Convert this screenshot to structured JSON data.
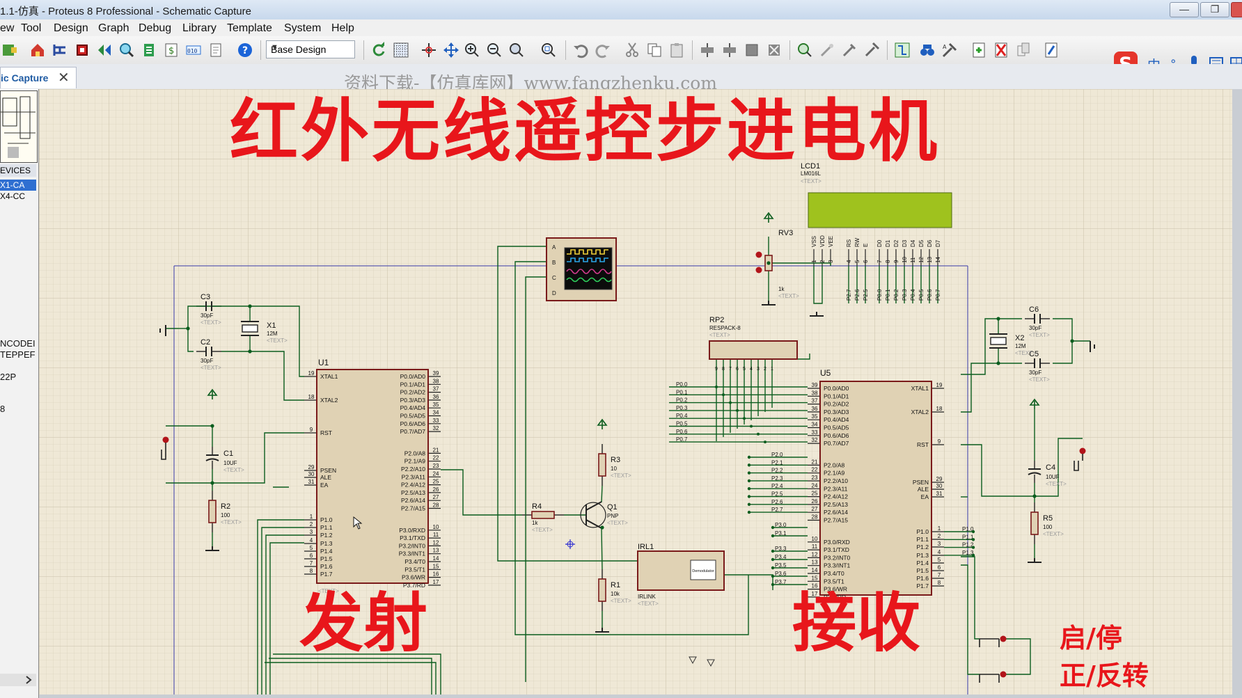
{
  "window": {
    "title": "1.1-仿真 - Proteus 8 Professional - Schematic Capture"
  },
  "menu": [
    "ew",
    "Tool",
    "Design",
    "Graph",
    "Debug",
    "Library",
    "Template",
    "System",
    "Help"
  ],
  "toolbar": {
    "design_select": "Base Design"
  },
  "tab": {
    "label": "ic Capture",
    "close": "✕"
  },
  "watermark": "资料下载-【仿真库网】www.fangzhenku.com",
  "sidebar": {
    "devices_header": "EVICES",
    "devices": [
      "X1-CA",
      "X4-CC"
    ],
    "fragments": [
      "NCODEI",
      "TEPPEF",
      "22P",
      "8"
    ]
  },
  "annotations": {
    "title": "红外无线遥控步进电机",
    "transmit": "发射",
    "receive": "接收",
    "start_stop": "启/停",
    "direction": "正/反转"
  },
  "schematic": {
    "text_tag": "<TEXT>",
    "u1": {
      "ref": "U1",
      "left_pins": [
        [
          "19",
          "XTAL1"
        ],
        [
          "18",
          "XTAL2"
        ],
        [
          "9",
          "RST"
        ],
        [
          "29",
          "PSEN"
        ],
        [
          "30",
          "ALE"
        ],
        [
          "31",
          "EA"
        ],
        [
          "1",
          "P1.0"
        ],
        [
          "2",
          "P1.1"
        ],
        [
          "3",
          "P1.2"
        ],
        [
          "4",
          "P1.3"
        ],
        [
          "5",
          "P1.4"
        ],
        [
          "6",
          "P1.5"
        ],
        [
          "7",
          "P1.6"
        ],
        [
          "8",
          "P1.7"
        ]
      ],
      "right_pins": [
        [
          "39",
          "P0.0/AD0"
        ],
        [
          "38",
          "P0.1/AD1"
        ],
        [
          "37",
          "P0.2/AD2"
        ],
        [
          "36",
          "P0.3/AD3"
        ],
        [
          "35",
          "P0.4/AD4"
        ],
        [
          "34",
          "P0.5/AD5"
        ],
        [
          "33",
          "P0.6/AD6"
        ],
        [
          "32",
          "P0.7/AD7"
        ],
        [
          "21",
          "P2.0/A8"
        ],
        [
          "22",
          "P2.1/A9"
        ],
        [
          "23",
          "P2.2/A10"
        ],
        [
          "24",
          "P2.3/A11"
        ],
        [
          "25",
          "P2.4/A12"
        ],
        [
          "26",
          "P2.5/A13"
        ],
        [
          "27",
          "P2.6/A14"
        ],
        [
          "28",
          "P2.7/A15"
        ],
        [
          "10",
          "P3.0/RXD"
        ],
        [
          "11",
          "P3.1/TXD"
        ],
        [
          "12",
          "P3.2/INT0"
        ],
        [
          "13",
          "P3.3/INT1"
        ],
        [
          "14",
          "P3.4/T0"
        ],
        [
          "15",
          "P3.5/T1"
        ],
        [
          "16",
          "P3.6/WR"
        ],
        [
          "17",
          "P3.7/RD"
        ]
      ]
    },
    "u5": {
      "ref": "U5",
      "left_pins": [
        [
          "39",
          "P0.0/AD0"
        ],
        [
          "38",
          "P0.1/AD1"
        ],
        [
          "37",
          "P0.2/AD2"
        ],
        [
          "36",
          "P0.3/AD3"
        ],
        [
          "35",
          "P0.4/AD4"
        ],
        [
          "34",
          "P0.5/AD5"
        ],
        [
          "33",
          "P0.6/AD6"
        ],
        [
          "32",
          "P0.7/AD7"
        ],
        [
          "21",
          "P2.0/A8"
        ],
        [
          "22",
          "P2.1/A9"
        ],
        [
          "23",
          "P2.2/A10"
        ],
        [
          "24",
          "P2.3/A11"
        ],
        [
          "25",
          "P2.4/A12"
        ],
        [
          "26",
          "P2.5/A13"
        ],
        [
          "27",
          "P2.6/A14"
        ],
        [
          "28",
          "P2.7/A15"
        ],
        [
          "10",
          "P3.0/RXD"
        ],
        [
          "11",
          "P3.1/TXD"
        ],
        [
          "12",
          "P3.2/INT0"
        ],
        [
          "13",
          "P3.3/INT1"
        ],
        [
          "14",
          "P3.4/T0"
        ],
        [
          "15",
          "P3.5/T1"
        ],
        [
          "16",
          "P3.6/WR"
        ],
        [
          "17",
          "P3.7/RD"
        ]
      ],
      "right_pins": [
        [
          "19",
          "XTAL1"
        ],
        [
          "18",
          "XTAL2"
        ],
        [
          "9",
          "RST"
        ],
        [
          "29",
          "PSEN"
        ],
        [
          "30",
          "ALE"
        ],
        [
          "31",
          "EA"
        ],
        [
          "1",
          "P1.0"
        ],
        [
          "2",
          "P1.1"
        ],
        [
          "3",
          "P1.2"
        ],
        [
          "4",
          "P1.3"
        ],
        [
          "5",
          "P1.4"
        ],
        [
          "6",
          "P1.5"
        ],
        [
          "7",
          "P1.6"
        ],
        [
          "8",
          "P1.7"
        ]
      ]
    },
    "net_p0": [
      "P0.0",
      "P0.1",
      "P0.2",
      "P0.3",
      "P0.4",
      "P0.5",
      "P0.6",
      "P0.7"
    ],
    "net_p2": [
      "P2.0",
      "P2.1",
      "P2.2",
      "P2.3",
      "P2.4",
      "P2.5",
      "P2.6",
      "P2.7"
    ],
    "net_p3": [
      "P3.0",
      "P3.1",
      "P3.3",
      "P3.4",
      "P3.5",
      "P3.6",
      "P3.7"
    ],
    "net_p1": [
      "P1.0",
      "P1.1",
      "P1.2",
      "P1.3"
    ],
    "lcd": {
      "ref": "LCD1",
      "part": "LM016L",
      "pins": [
        "VSS",
        "VDD",
        "VEE",
        "RS",
        "RW",
        "E",
        "D0",
        "D1",
        "D2",
        "D3",
        "D4",
        "D5",
        "D6",
        "D7"
      ],
      "pin_numbers": [
        "1",
        "2",
        "3",
        "4",
        "5",
        "6",
        "7",
        "8",
        "9",
        "10",
        "11",
        "12",
        "13",
        "14"
      ],
      "nets": [
        "P2.7",
        "P2.6",
        "P2.5",
        "P0.0",
        "P0.1",
        "P0.2",
        "P0.3",
        "P0.4",
        "P0.5",
        "P0.6",
        "P0.7"
      ]
    },
    "rp2": {
      "ref": "RP2",
      "part": "RESPACK-8",
      "pins": [
        "9",
        "8",
        "7",
        "6",
        "5",
        "4",
        "3",
        "2",
        "1"
      ]
    },
    "scope": {
      "channels": [
        "A",
        "B",
        "C",
        "D"
      ]
    },
    "parts": {
      "C3": {
        "ref": "C3",
        "val": "30pF"
      },
      "C2": {
        "ref": "C2",
        "val": "30pF"
      },
      "X1": {
        "ref": "X1",
        "val": "12M"
      },
      "C1": {
        "ref": "C1",
        "val": "10UF"
      },
      "R2": {
        "ref": "R2",
        "val": "100"
      },
      "R4": {
        "ref": "R4",
        "val": "1k"
      },
      "R3": {
        "ref": "R3",
        "val": "10"
      },
      "R1": {
        "ref": "R1",
        "val": "10k"
      },
      "Q1": {
        "ref": "Q1",
        "val": "PNP"
      },
      "IRL1": {
        "ref": "IRL1",
        "val": "IRLINK",
        "demod": "Demodulator"
      },
      "RV3": {
        "ref": "RV3",
        "val": "1k"
      },
      "C6": {
        "ref": "C6",
        "val": "30pF"
      },
      "C5": {
        "ref": "C5",
        "val": "30pF"
      },
      "X2": {
        "ref": "X2",
        "val": "12M"
      },
      "C4": {
        "ref": "C4",
        "val": "10UF"
      },
      "R5": {
        "ref": "R5",
        "val": "100"
      }
    }
  }
}
